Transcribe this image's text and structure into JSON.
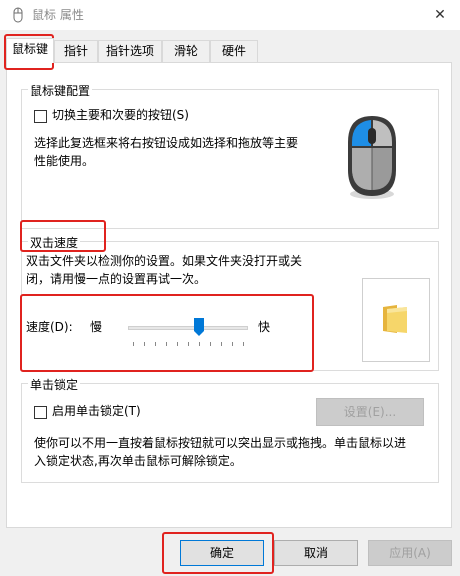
{
  "window": {
    "title": "鼠标 属性",
    "close_glyph": "✕"
  },
  "tabs": [
    {
      "label": "鼠标键",
      "active": true
    },
    {
      "label": "指针",
      "active": false
    },
    {
      "label": "指针选项",
      "active": false
    },
    {
      "label": "滑轮",
      "active": false
    },
    {
      "label": "硬件",
      "active": false
    }
  ],
  "button_config": {
    "group_label": "鼠标键配置",
    "switch_checkbox_label": "切换主要和次要的按钮(S)",
    "switch_checked": false,
    "description_line1": "选择此复选框来将右按钮设成如选择和拖放等主要",
    "description_line2": "性能使用。"
  },
  "double_click": {
    "group_label": "双击速度",
    "description_line1": "双击文件夹以检测你的设置。如果文件夹没打开或关",
    "description_line2": "闭，请用慢一点的设置再试一次。",
    "speed_label": "速度(D):",
    "slow_label": "慢",
    "fast_label": "快",
    "speed_value": 0.6
  },
  "click_lock": {
    "group_label": "单击锁定",
    "checkbox_label": "启用单击锁定(T)",
    "checked": false,
    "settings_button": "设置(E)...",
    "description_line1": "使你可以不用一直按着鼠标按钮就可以突出显示或拖拽。单击鼠标以进",
    "description_line2": "入锁定状态,再次单击鼠标可解除锁定。"
  },
  "footer": {
    "ok_label": "确定",
    "cancel_label": "取消",
    "apply_label": "应用(A)"
  },
  "colors": {
    "highlight": "#e0231f",
    "accent": "#0078d7"
  }
}
